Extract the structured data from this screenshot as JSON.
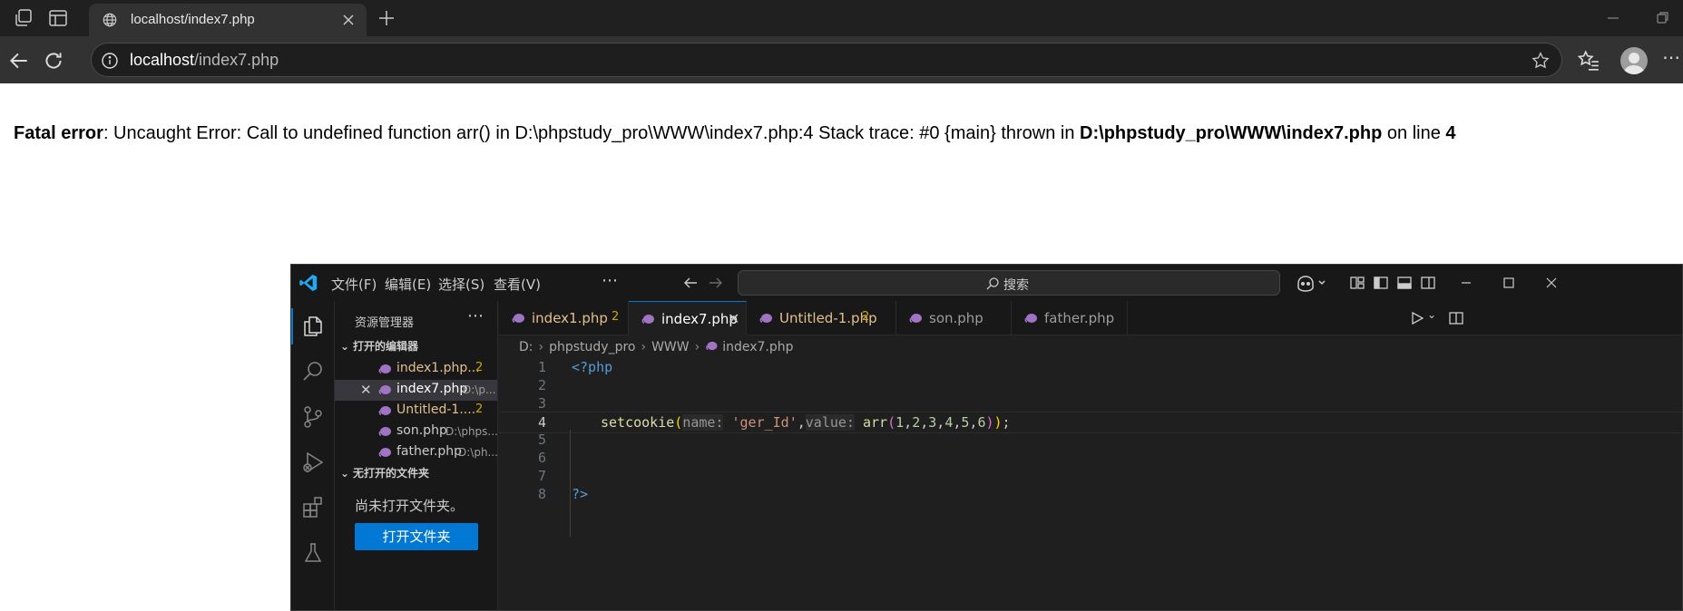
{
  "browser": {
    "tab_title": "localhost/index7.php",
    "url_host": "localhost",
    "url_path": "/index7.php"
  },
  "page": {
    "error_label": "Fatal error",
    "error_message": ": Uncaught Error: Call to undefined function arr() in D:\\phpstudy_pro\\WWW\\index7.php:4 Stack trace: #0 {main} thrown in ",
    "error_file": "D:\\phpstudy_pro\\WWW\\index7.php",
    "error_on_line": " on line ",
    "error_line": "4"
  },
  "vscode": {
    "menu": [
      "文件(F)",
      "编辑(E)",
      "选择(S)",
      "查看(V)"
    ],
    "search_placeholder": "搜索",
    "sidebar": {
      "title": "资源管理器",
      "open_editors_label": "打开的编辑器",
      "open_editors": [
        {
          "name": "index1.php...",
          "path": "",
          "count": "2",
          "color": "#e2c08d"
        },
        {
          "name": "index7.php",
          "path": "D:\\p...",
          "count": "",
          "color": "#cccccc"
        },
        {
          "name": "Untitled-1....",
          "path": "",
          "count": "2",
          "color": "#e2c08d"
        },
        {
          "name": "son.php",
          "path": "D:\\phps...",
          "count": "",
          "color": "#cccccc"
        },
        {
          "name": "father.php",
          "path": "D:\\ph...",
          "count": "",
          "color": "#cccccc"
        }
      ],
      "no_folder_label": "无打开的文件夹",
      "empty_message": "尚未打开文件夹。",
      "open_folder_button": "打开文件夹"
    },
    "tabs": [
      {
        "label": "index1.php",
        "count": "2",
        "color": "#e2c08d"
      },
      {
        "label": "index7.php",
        "count": "",
        "color": "#ffffff"
      },
      {
        "label": "Untitled-1.php",
        "count": "2",
        "color": "#e2c08d"
      },
      {
        "label": "son.php",
        "count": "",
        "color": "#9d9d9d"
      },
      {
        "label": "father.php",
        "count": "",
        "color": "#9d9d9d"
      }
    ],
    "breadcrumb": [
      "D:",
      "phpstudy_pro",
      "WWW",
      "index7.php"
    ],
    "line_numbers": [
      "1",
      "2",
      "3",
      "4",
      "5",
      "6",
      "7",
      "8"
    ],
    "code": {
      "open_tag": "<?php",
      "fn_setcookie": "setcookie",
      "hint_name": "name:",
      "str_name": "'ger_Id'",
      "hint_value": "value:",
      "fn_arr": "arr",
      "nums": [
        "1",
        "2",
        "3",
        "4",
        "5",
        "6"
      ],
      "close_tag": "?>"
    }
  }
}
